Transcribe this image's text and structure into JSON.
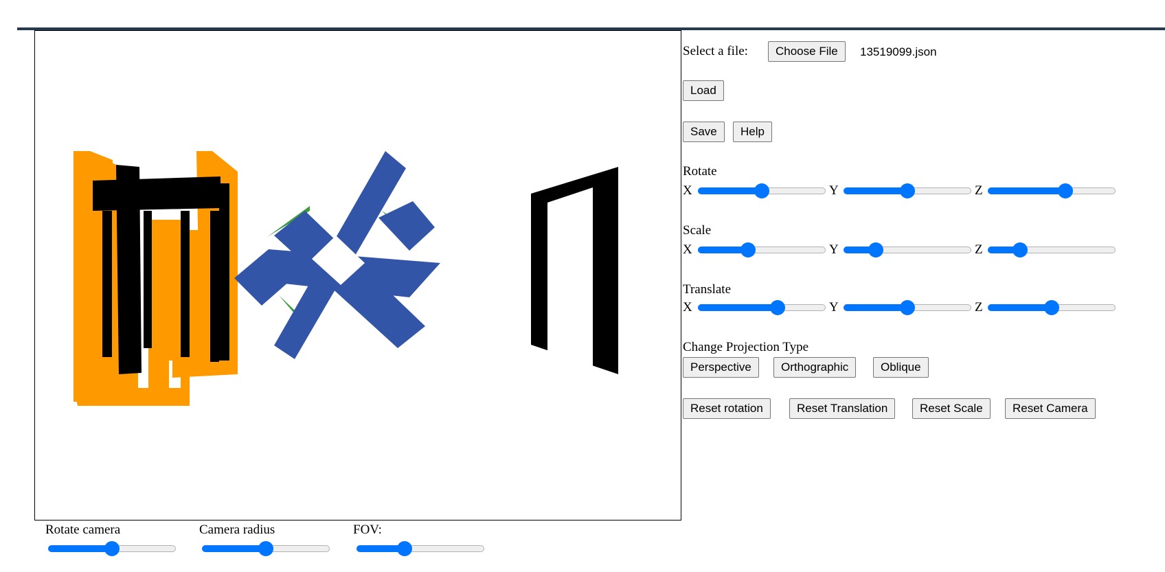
{
  "file": {
    "select_label": "Select a file:",
    "choose_button": "Choose File",
    "file_name": "13519099.json"
  },
  "buttons": {
    "load": "Load",
    "save": "Save",
    "help": "Help"
  },
  "rotate": {
    "title": "Rotate",
    "x_label": "X",
    "y_label": "Y",
    "z_label": "Z",
    "x_value": 0.5,
    "y_value": 0.5,
    "z_value": 0.62
  },
  "scale": {
    "title": "Scale",
    "x_label": "X",
    "y_label": "Y",
    "z_label": "Z",
    "x_value": 0.38,
    "y_value": 0.22,
    "z_value": 0.22
  },
  "translate": {
    "title": "Translate",
    "x_label": "X",
    "y_label": "Y",
    "z_label": "Z",
    "x_value": 0.64,
    "y_value": 0.5,
    "z_value": 0.5
  },
  "projection": {
    "title": "Change Projection Type",
    "perspective": "Perspective",
    "orthographic": "Orthographic",
    "oblique": "Oblique"
  },
  "reset": {
    "rotation": "Reset rotation",
    "translation": "Reset Translation",
    "scale": "Reset Scale",
    "camera": "Reset Camera"
  },
  "camera": {
    "rotate_label": "Rotate camera",
    "radius_label": "Camera radius",
    "fov_label": "FOV:",
    "rotate_value": 0.5,
    "radius_value": 0.5,
    "fov_value": 0.36
  },
  "colors": {
    "accent": "#0075ff",
    "orange": "#ff9900",
    "blue": "#3355a8",
    "black": "#000000",
    "green": "#3a9b3a",
    "topbar": "#263a4f"
  }
}
